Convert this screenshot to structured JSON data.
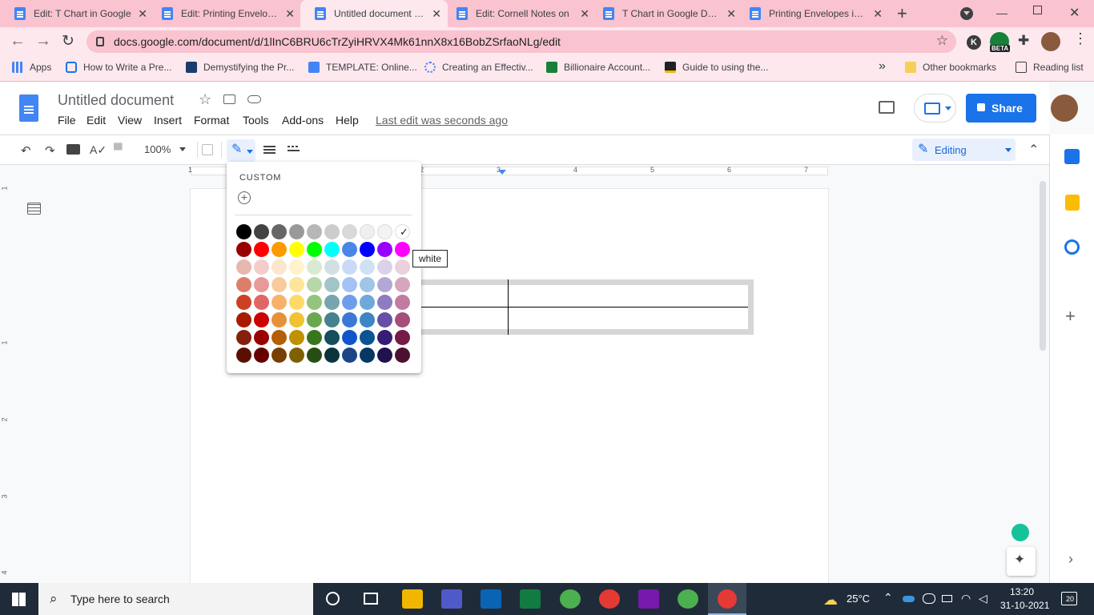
{
  "browser": {
    "tabs": [
      {
        "title": "Edit: T Chart in Google",
        "active": false
      },
      {
        "title": "Edit: Printing Envelopes",
        "active": false
      },
      {
        "title": "Untitled document - Google Docs",
        "active": true
      },
      {
        "title": "Edit: Cornell Notes on",
        "active": false
      },
      {
        "title": "T Chart in Google Docs",
        "active": false
      },
      {
        "title": "Printing Envelopes in Google",
        "active": false
      }
    ],
    "new_tab": "+",
    "url": "docs.google.com/document/d/1lInC6BRU6cTrZyiHRVX4Mk61nnX8x16BobZSrfaoNLg/edit",
    "profile_initial": "K",
    "beta_label": "BETA",
    "bookmarks": [
      {
        "label": "Apps"
      },
      {
        "label": "How to Write a Pre..."
      },
      {
        "label": "Demystifying the Pr..."
      },
      {
        "label": "TEMPLATE: Online..."
      },
      {
        "label": "Creating an Effectiv..."
      },
      {
        "label": "Billionaire Account..."
      },
      {
        "label": "Guide to using the..."
      }
    ],
    "more_bookmarks": "»",
    "other_bookmarks": "Other bookmarks",
    "reading_list": "Reading list"
  },
  "doc": {
    "title": "Untitled document",
    "menus": [
      "File",
      "Edit",
      "View",
      "Insert",
      "Format",
      "Tools",
      "Add-ons",
      "Help"
    ],
    "last_edit": "Last edit was seconds ago",
    "share_label": "Share",
    "zoom": "100%",
    "mode": "Editing",
    "ruler_marks": [
      "1",
      "2",
      "3",
      "4",
      "5",
      "6",
      "7"
    ],
    "vruler_marks": [
      "1",
      "1",
      "2",
      "3",
      "4"
    ]
  },
  "palette": {
    "custom_label": "CUSTOM",
    "tooltip": "white",
    "selected": "white",
    "rows": [
      [
        "#000000",
        "#434343",
        "#666666",
        "#999999",
        "#b7b7b7",
        "#cccccc",
        "#d9d9d9",
        "#efefef",
        "#f3f3f3",
        "#ffffff"
      ],
      [
        "#980000",
        "#ff0000",
        "#ff9900",
        "#ffff00",
        "#00ff00",
        "#00ffff",
        "#4a86e8",
        "#0000ff",
        "#9900ff",
        "#ff00ff"
      ],
      [
        "#e6b8af",
        "#f4cccc",
        "#fce5cd",
        "#fff2cc",
        "#d9ead3",
        "#d0e0e3",
        "#c9daf8",
        "#cfe2f3",
        "#d9d2e9",
        "#ead1dc"
      ],
      [
        "#dd7e6b",
        "#ea9999",
        "#f9cb9c",
        "#ffe599",
        "#b6d7a8",
        "#a2c4c9",
        "#a4c2f4",
        "#9fc5e8",
        "#b4a7d6",
        "#d5a6bd"
      ],
      [
        "#cc4125",
        "#e06666",
        "#f6b26b",
        "#ffd966",
        "#93c47d",
        "#76a5af",
        "#6d9eeb",
        "#6fa8dc",
        "#8e7cc3",
        "#c27ba0"
      ],
      [
        "#a61c00",
        "#cc0000",
        "#e69138",
        "#f1c232",
        "#6aa84f",
        "#45818e",
        "#3c78d8",
        "#3d85c6",
        "#674ea7",
        "#a64d79"
      ],
      [
        "#85200c",
        "#990000",
        "#b45f06",
        "#bf9000",
        "#38761d",
        "#134f5c",
        "#1155cc",
        "#0b5394",
        "#351c75",
        "#741b47"
      ],
      [
        "#5b0f00",
        "#660000",
        "#783f04",
        "#7f6000",
        "#274e13",
        "#0c343d",
        "#1c4587",
        "#073763",
        "#20124d",
        "#4c1130"
      ]
    ]
  },
  "taskbar": {
    "search_placeholder": "Type here to search",
    "weather": "25°C",
    "time": "13:20",
    "date": "31-10-2021",
    "notifications": "20"
  }
}
